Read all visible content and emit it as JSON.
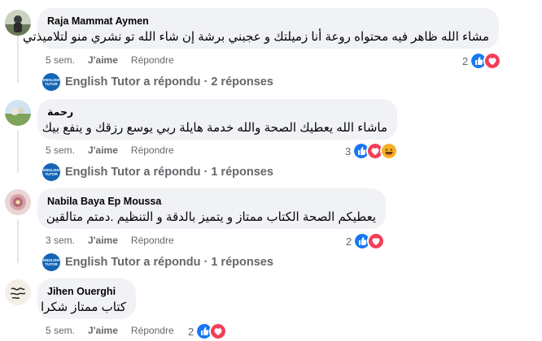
{
  "comments": [
    {
      "author": "Raja Mammat Aymen",
      "text": "مشاء الله ظاهر فيه محتواه روعة أنا زميلتك و عجبني برشة إن شاء الله تو نشري منو لتلاميذتي",
      "time": "5 sem.",
      "like": "J'aime",
      "reply": "Répondre",
      "reaction_count": "2",
      "reactions": [
        "like-reaction-icon",
        "love-reaction-icon"
      ],
      "replies": {
        "name": "English Tutor",
        "action": "a répondu",
        "count": "2 réponses"
      }
    },
    {
      "author": "رحمة",
      "text": "ماشاء الله يعطيك الصحة والله خدمة هايلة ربي يوسع رزقك و ينفع بيك",
      "time": "5 sem.",
      "like": "J'aime",
      "reply": "Répondre",
      "reaction_count": "3",
      "reactions": [
        "like-reaction-icon",
        "love-reaction-icon",
        "haha-reaction-icon"
      ],
      "replies": {
        "name": "English Tutor",
        "action": "a répondu",
        "count": "1 réponses"
      }
    },
    {
      "author": "Nabila Baya Ep Moussa",
      "text": "يعطيكم الصحة الكتاب ممتاز و يتميز بالدقة و التنظيم .دمتم متالقين",
      "time": "3 sem.",
      "like": "J'aime",
      "reply": "Répondre",
      "reaction_count": "2",
      "reactions": [
        "like-reaction-icon",
        "love-reaction-icon"
      ],
      "replies": {
        "name": "English Tutor",
        "action": "a répondu",
        "count": "1 réponses"
      }
    },
    {
      "author": "Jihen Ouerghi",
      "text": "كتاب ممتاز شكرا",
      "time": "5 sem.",
      "like": "J'aime",
      "reply": "Répondre",
      "reaction_count": "2",
      "reactions": [
        "like-reaction-icon",
        "love-reaction-icon"
      ]
    }
  ],
  "page_avatar_text": {
    "line1": "ENGLISH",
    "line2": "TUTOR"
  },
  "separator": "·",
  "colors": {
    "like": "#1877f2",
    "love": "#f33e58",
    "haha": "#f7b125",
    "bubble": "#f0f2f5",
    "meta": "#65676b"
  }
}
